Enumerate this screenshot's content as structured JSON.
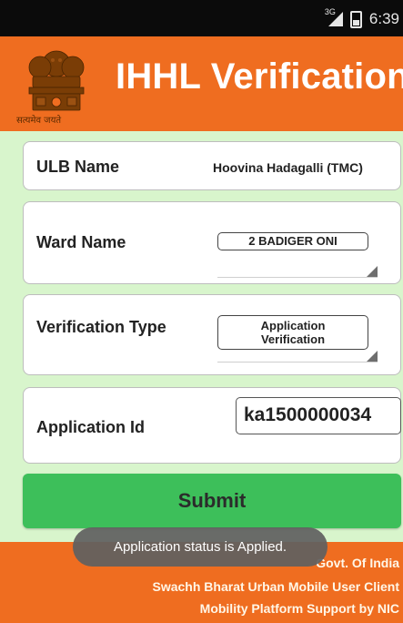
{
  "status_bar": {
    "network": "3G",
    "time": "6:39"
  },
  "header": {
    "emblem_caption": "सत्यमेव जयते",
    "title": "IHHL Verification"
  },
  "form": {
    "ulb": {
      "label": "ULB Name",
      "value": "Hoovina Hadagalli (TMC)"
    },
    "ward": {
      "label": "Ward Name",
      "value": "2 BADIGER ONI"
    },
    "verification_type": {
      "label": "Verification Type",
      "value_line1": "Application",
      "value_line2": "Verification"
    },
    "application_id": {
      "label": "Application Id",
      "value": "ka1500000034"
    }
  },
  "submit_label": "Submit",
  "toast": "Application status is Applied.",
  "footer": {
    "line1": "Govt. Of India",
    "line2": "Swachh Bharat Urban Mobile User Client",
    "line3": "Mobility Platform Support by NIC"
  },
  "colors": {
    "header_bg": "#ef6d20",
    "page_bg": "#d8f5cc",
    "submit_bg": "#3dbf5a",
    "toast_bg": "#606060"
  },
  "icons": [
    "signal-icon",
    "battery-icon",
    "state-emblem-icon",
    "dropdown-triangle-icon"
  ]
}
